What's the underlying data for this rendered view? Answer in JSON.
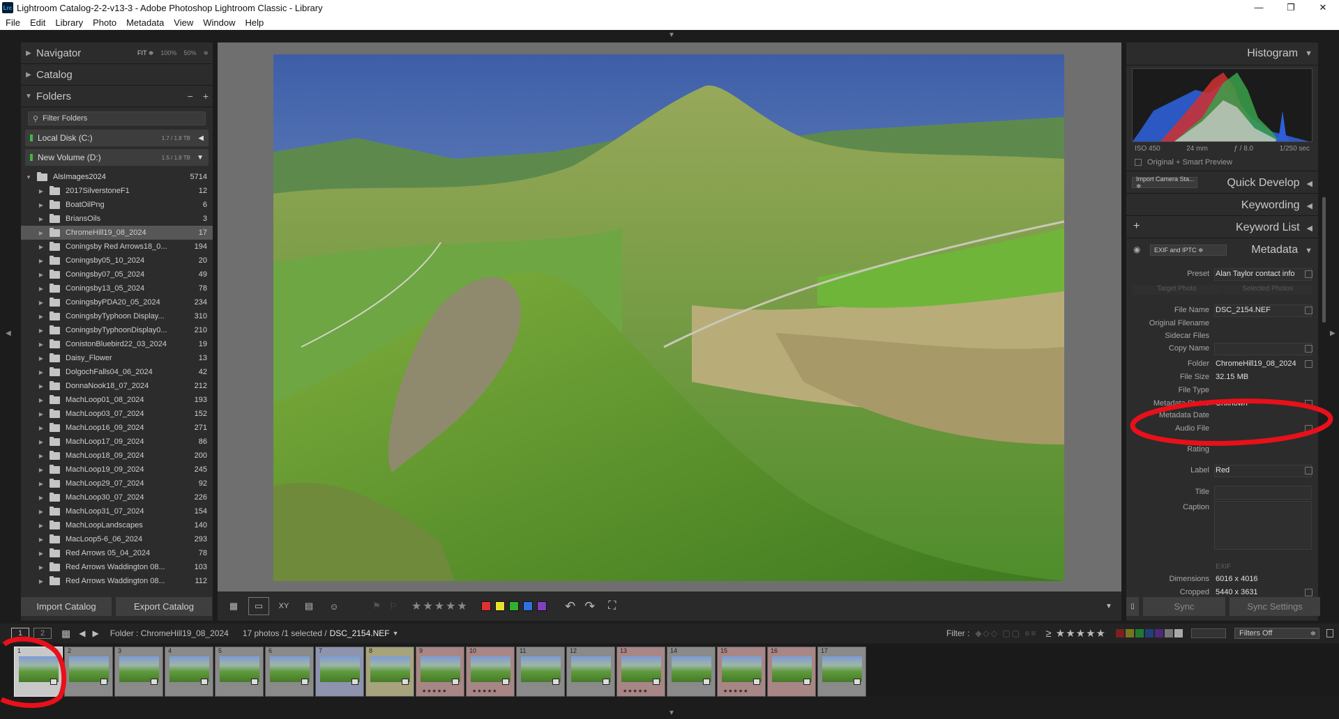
{
  "window": {
    "title": "Lightroom Catalog-2-2-v13-3 - Adobe Photoshop Lightroom Classic - Library",
    "app_icon": "Lrc",
    "controls": [
      "—",
      "❐",
      "✕"
    ]
  },
  "menu": [
    "File",
    "Edit",
    "Library",
    "Photo",
    "Metadata",
    "View",
    "Window",
    "Help"
  ],
  "left": {
    "navigator": {
      "label": "Navigator",
      "fit": "FIT ≑",
      "z100": "100%",
      "z50": "50%",
      "zstep": "≑"
    },
    "catalog_label": "Catalog",
    "folders": {
      "label": "Folders",
      "minus": "−",
      "plus": "+",
      "filter_placeholder": "Filter Folders",
      "volumes": [
        {
          "name": "Local Disk (C:)",
          "cap": "1.7 / 1.8 TB",
          "arrow": "◀"
        },
        {
          "name": "New Volume (D:)",
          "cap": "1.5 / 1.8 TB",
          "arrow": "▼"
        }
      ],
      "root": {
        "name": "AlsImages2024",
        "count": "5714"
      },
      "items": [
        {
          "name": "2017SilverstoneF1",
          "count": "12"
        },
        {
          "name": "BoatOilPng",
          "count": "6"
        },
        {
          "name": "BriansOils",
          "count": "3"
        },
        {
          "name": "ChromeHill19_08_2024",
          "count": "17"
        },
        {
          "name": "Coningsby Red Arrows18_0...",
          "count": "194"
        },
        {
          "name": "Coningsby05_10_2024",
          "count": "20"
        },
        {
          "name": "Coningsby07_05_2024",
          "count": "49"
        },
        {
          "name": "Coningsby13_05_2024",
          "count": "78"
        },
        {
          "name": "ConingsbyPDA20_05_2024",
          "count": "234"
        },
        {
          "name": "ConingsbyTyphoon Display...",
          "count": "310"
        },
        {
          "name": "ConingsbyTyphoonDisplay0...",
          "count": "210"
        },
        {
          "name": "ConistonBluebird22_03_2024",
          "count": "19"
        },
        {
          "name": "Daisy_Flower",
          "count": "13"
        },
        {
          "name": "DolgochFalls04_06_2024",
          "count": "42"
        },
        {
          "name": "DonnaNook18_07_2024",
          "count": "212"
        },
        {
          "name": "MachLoop01_08_2024",
          "count": "193"
        },
        {
          "name": "MachLoop03_07_2024",
          "count": "152"
        },
        {
          "name": "MachLoop16_09_2024",
          "count": "271"
        },
        {
          "name": "MachLoop17_09_2024",
          "count": "86"
        },
        {
          "name": "MachLoop18_09_2024",
          "count": "200"
        },
        {
          "name": "MachLoop19_09_2024",
          "count": "245"
        },
        {
          "name": "MachLoop29_07_2024",
          "count": "92"
        },
        {
          "name": "MachLoop30_07_2024",
          "count": "226"
        },
        {
          "name": "MachLoop31_07_2024",
          "count": "154"
        },
        {
          "name": "MachLoopLandscapes",
          "count": "140"
        },
        {
          "name": "MacLoop5-6_06_2024",
          "count": "293"
        },
        {
          "name": "Red Arrows 05_04_2024",
          "count": "78"
        },
        {
          "name": "Red Arrows Waddington 08...",
          "count": "103"
        },
        {
          "name": "Red Arrows Waddington 08...",
          "count": "112"
        }
      ]
    },
    "import_catalog": "Import Catalog",
    "export_catalog": "Export Catalog"
  },
  "toolbar": {
    "stars": "★★★★★",
    "labels": [
      "#e03030",
      "#e8e030",
      "#30b030",
      "#3070e0",
      "#8040c0"
    ]
  },
  "right": {
    "histogram_label": "Histogram",
    "iso": "ISO 450",
    "focal": "24 mm",
    "aperture": "ƒ / 8.0",
    "shutter": "1/250 sec",
    "smart_preview": "Original + Smart Preview",
    "camera_preset": "Import Camera Sta... ≑",
    "quick_develop": "Quick Develop",
    "keywording": "Keywording",
    "keyword_list": "Keyword List",
    "plus": "+",
    "exif_select": "EXIF and IPTC ≑",
    "metadata": "Metadata",
    "preset_label": "Preset",
    "preset_value": "Alan Taylor contact info",
    "target_photo": "Target Photo",
    "selected_photos": "Selected Photos",
    "fields": {
      "file_name": {
        "label": "File Name",
        "value": "DSC_2154.NEF"
      },
      "original_filename": {
        "label": "Original Filename",
        "value": ""
      },
      "sidecar": {
        "label": "Sidecar Files",
        "value": ""
      },
      "copy_name": {
        "label": "Copy Name",
        "value": ""
      },
      "folder": {
        "label": "Folder",
        "value": "ChromeHill19_08_2024"
      },
      "file_size": {
        "label": "File Size",
        "value": "32.15 MB"
      },
      "file_type": {
        "label": "File Type",
        "value": ""
      },
      "metadata_status": {
        "label": "Metadata Status",
        "value": "Unknown"
      },
      "metadata_date": {
        "label": "Metadata Date",
        "value": ""
      },
      "audio_file": {
        "label": "Audio File",
        "value": ""
      },
      "rating": {
        "label": "Rating",
        "value": ""
      },
      "label": {
        "label": "Label",
        "value": "Red"
      },
      "title": {
        "label": "Title",
        "value": ""
      },
      "caption": {
        "label": "Caption",
        "value": ""
      },
      "exif_header": "EXIF",
      "dimensions": {
        "label": "Dimensions",
        "value": "6016 x 4016"
      },
      "cropped": {
        "label": "Cropped",
        "value": "5440 x 3631"
      }
    },
    "sync": "Sync",
    "sync_settings": "Sync Settings"
  },
  "filmstrip_bar": {
    "screen1": "1",
    "screen2": "2",
    "folder_label": "Folder : ChromeHill19_08_2024",
    "count_label": "17 photos /1 selected /",
    "selected_file": "DSC_2154.NEF",
    "filter_label": "Filter :",
    "stars": "≥ ★★★★★",
    "filter_select": "Filters Off",
    "filter_arrow": "≑"
  },
  "filmstrip": [
    {
      "num": "1",
      "stars": "",
      "tint": "#9a9a9a",
      "selected": true
    },
    {
      "num": "2",
      "stars": "",
      "tint": "#8a8a8a"
    },
    {
      "num": "3",
      "stars": "",
      "tint": "#8a8a8a"
    },
    {
      "num": "4",
      "stars": "",
      "tint": "#8a8a8a"
    },
    {
      "num": "5",
      "stars": "",
      "tint": "#8a8a8a"
    },
    {
      "num": "6",
      "stars": "",
      "tint": "#8a8a8a"
    },
    {
      "num": "7",
      "stars": "",
      "tint": "#8e93ae"
    },
    {
      "num": "8",
      "stars": "",
      "tint": "#a7a37c"
    },
    {
      "num": "9",
      "stars": "★★★★★",
      "tint": "#a88686"
    },
    {
      "num": "10",
      "stars": "★★★★★",
      "tint": "#a88686"
    },
    {
      "num": "11",
      "stars": "",
      "tint": "#8a8a8a"
    },
    {
      "num": "12",
      "stars": "",
      "tint": "#8a8a8a"
    },
    {
      "num": "13",
      "stars": "★★★★★",
      "tint": "#a88686"
    },
    {
      "num": "14",
      "stars": "",
      "tint": "#8a8a8a"
    },
    {
      "num": "15",
      "stars": "★★★★★",
      "tint": "#a88686"
    },
    {
      "num": "16",
      "stars": "",
      "tint": "#a88686"
    },
    {
      "num": "17",
      "stars": "",
      "tint": "#8a8a8a"
    }
  ],
  "annotation_color": "#e8101a"
}
